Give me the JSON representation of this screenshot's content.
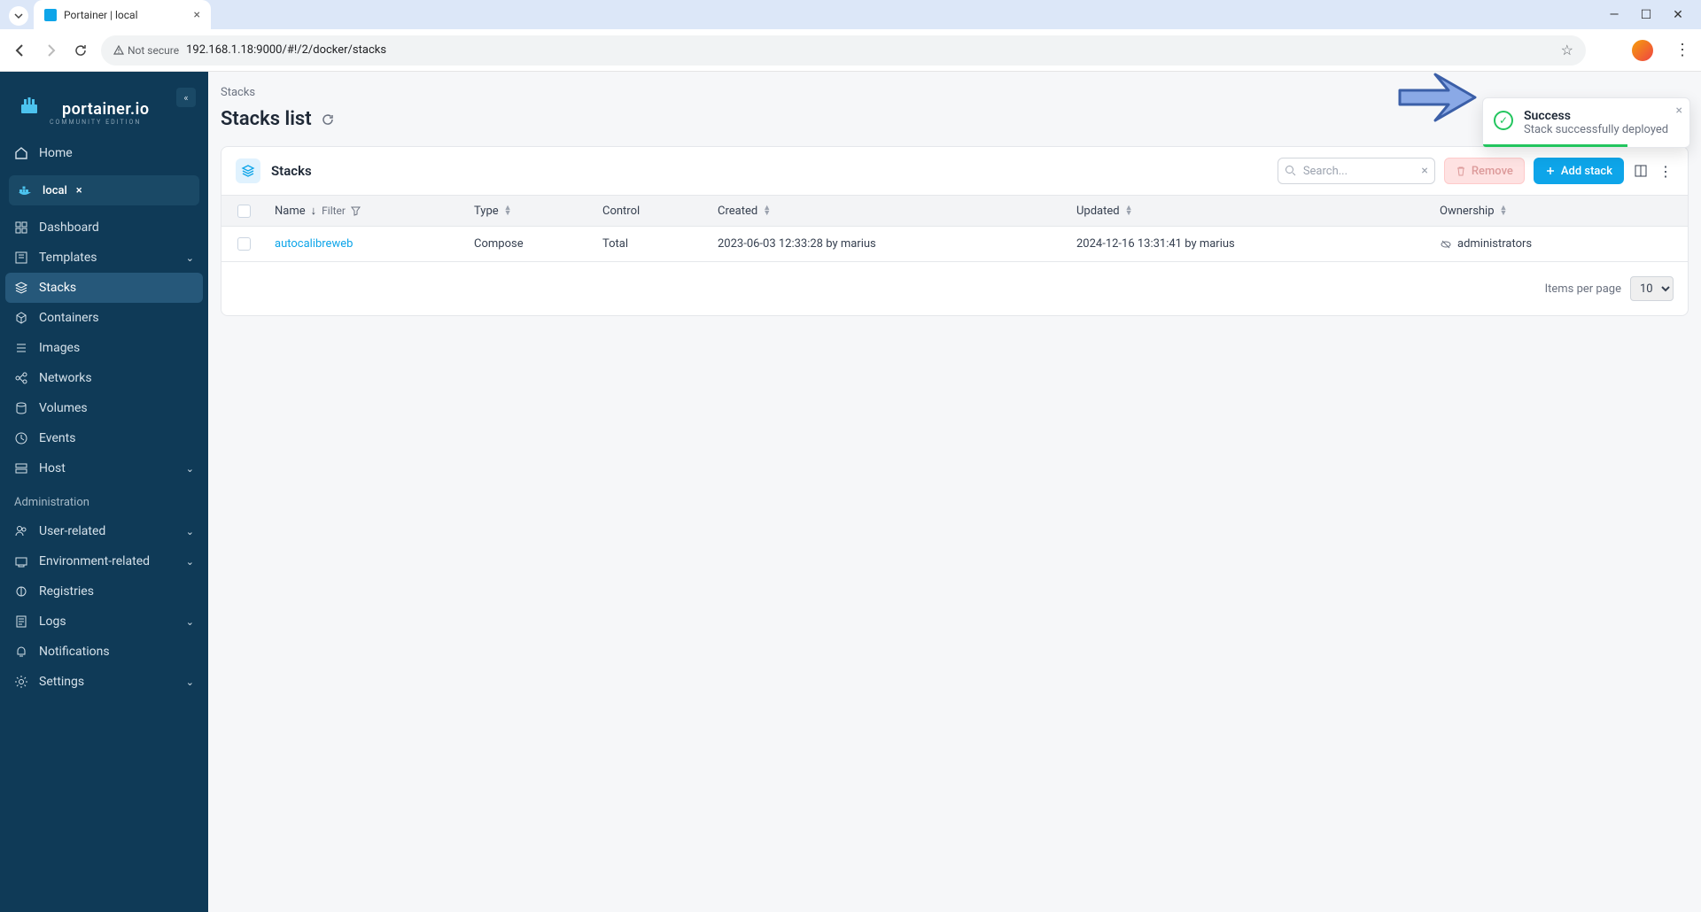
{
  "browser": {
    "tab_title": "Portainer | local",
    "not_secure": "Not secure",
    "url": "192.168.1.18:9000/#!/2/docker/stacks"
  },
  "sidebar": {
    "brand": "portainer.io",
    "edition": "COMMUNITY EDITION",
    "home": "Home",
    "env_name": "local",
    "items": [
      {
        "label": "Dashboard"
      },
      {
        "label": "Templates",
        "expandable": true
      },
      {
        "label": "Stacks",
        "active": true
      },
      {
        "label": "Containers"
      },
      {
        "label": "Images"
      },
      {
        "label": "Networks"
      },
      {
        "label": "Volumes"
      },
      {
        "label": "Events"
      },
      {
        "label": "Host",
        "expandable": true
      }
    ],
    "admin_label": "Administration",
    "admin_items": [
      {
        "label": "User-related",
        "expandable": true
      },
      {
        "label": "Environment-related",
        "expandable": true
      },
      {
        "label": "Registries"
      },
      {
        "label": "Logs",
        "expandable": true
      },
      {
        "label": "Notifications"
      },
      {
        "label": "Settings",
        "expandable": true
      }
    ]
  },
  "page": {
    "breadcrumb": "Stacks",
    "title": "Stacks list"
  },
  "panel": {
    "title": "Stacks",
    "search_placeholder": "Search...",
    "remove_label": "Remove",
    "add_label": "Add stack",
    "columns": {
      "name": "Name",
      "filter": "Filter",
      "type": "Type",
      "control": "Control",
      "created": "Created",
      "updated": "Updated",
      "ownership": "Ownership"
    },
    "rows": [
      {
        "name": "autocalibreweb",
        "type": "Compose",
        "control": "Total",
        "created": "2023-06-03 12:33:28 by marius",
        "updated": "2024-12-16 13:31:41 by marius",
        "ownership": "administrators"
      }
    ],
    "items_per_page_label": "Items per page",
    "items_per_page_value": "10"
  },
  "toast": {
    "title": "Success",
    "message": "Stack successfully deployed"
  }
}
